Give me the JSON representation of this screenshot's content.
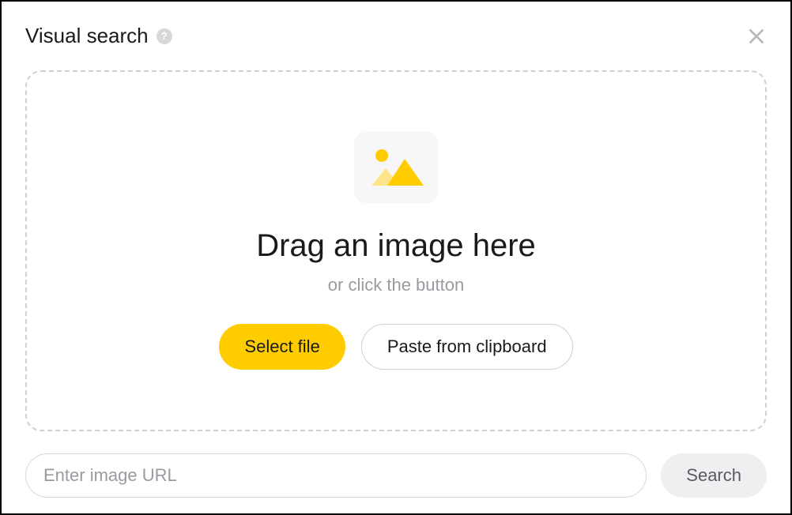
{
  "header": {
    "title": "Visual search"
  },
  "dropZone": {
    "title": "Drag an image here",
    "subtitle": "or click the button",
    "selectFileLabel": "Select file",
    "pasteClipboardLabel": "Paste from clipboard"
  },
  "urlRow": {
    "placeholder": "Enter image URL",
    "searchLabel": "Search"
  },
  "colors": {
    "accent": "#ffcc00"
  }
}
